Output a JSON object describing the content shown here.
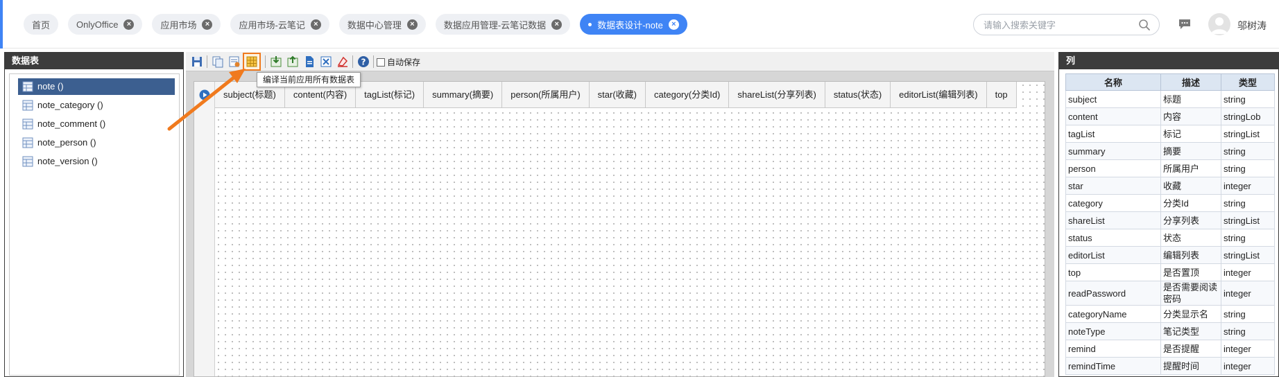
{
  "header": {
    "tabs": [
      {
        "label": "首页",
        "closable": false,
        "active": false
      },
      {
        "label": "OnlyOffice",
        "closable": true,
        "active": false
      },
      {
        "label": "应用市场",
        "closable": true,
        "active": false
      },
      {
        "label": "应用市场-云笔记",
        "closable": true,
        "active": false
      },
      {
        "label": "数据中心管理",
        "closable": true,
        "active": false
      },
      {
        "label": "数据应用管理-云笔记数据",
        "closable": true,
        "active": false
      },
      {
        "label": "数据表设计-note",
        "closable": true,
        "active": true
      }
    ],
    "search_placeholder": "请输入搜索关键字",
    "username": "邬树涛",
    "accent_color": "#3f84f5"
  },
  "left_panel": {
    "title": "数据表",
    "items": [
      {
        "label": "note ()",
        "selected": true
      },
      {
        "label": "note_category ()",
        "selected": false
      },
      {
        "label": "note_comment ()",
        "selected": false
      },
      {
        "label": "note_person ()",
        "selected": false
      },
      {
        "label": "note_version ()",
        "selected": false
      }
    ]
  },
  "toolbar": {
    "autosave_label": "自动保存",
    "tooltip": "编译当前应用所有数据表",
    "highlight_color": "#f07a1e"
  },
  "fields": [
    "subject(标题)",
    "content(内容)",
    "tagList(标记)",
    "summary(摘要)",
    "person(所属用户)",
    "star(收藏)",
    "category(分类Id)",
    "shareList(分享列表)",
    "status(状态)",
    "editorList(编辑列表)",
    "top"
  ],
  "right_panel": {
    "title": "列",
    "headers": [
      "名称",
      "描述",
      "类型"
    ],
    "rows": [
      [
        "subject",
        "标题",
        "string"
      ],
      [
        "content",
        "内容",
        "stringLob"
      ],
      [
        "tagList",
        "标记",
        "stringList"
      ],
      [
        "summary",
        "摘要",
        "string"
      ],
      [
        "person",
        "所属用户",
        "string"
      ],
      [
        "star",
        "收藏",
        "integer"
      ],
      [
        "category",
        "分类Id",
        "string"
      ],
      [
        "shareList",
        "分享列表",
        "stringList"
      ],
      [
        "status",
        "状态",
        "string"
      ],
      [
        "editorList",
        "编辑列表",
        "stringList"
      ],
      [
        "top",
        "是否置顶",
        "integer"
      ],
      [
        "readPassword",
        "是否需要阅读密码",
        "integer"
      ],
      [
        "categoryName",
        "分类显示名",
        "string"
      ],
      [
        "noteType",
        "笔记类型",
        "string"
      ],
      [
        "remind",
        "是否提醒",
        "integer"
      ],
      [
        "remindTime",
        "提醒时间",
        "integer"
      ]
    ]
  }
}
